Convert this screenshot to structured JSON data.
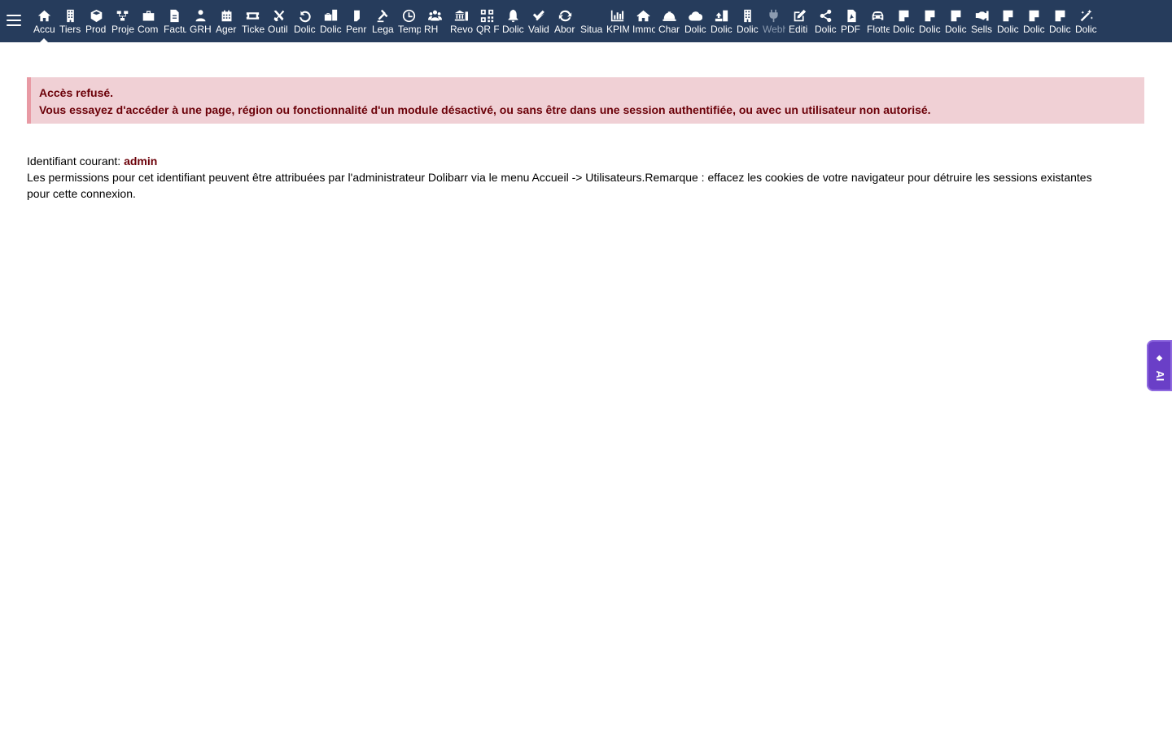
{
  "topbar": {
    "menu_items": [
      {
        "label": "Accu",
        "icon": "home-icon",
        "active": true
      },
      {
        "label": "Tiers",
        "icon": "building-icon"
      },
      {
        "label": "Prod",
        "icon": "cube-icon"
      },
      {
        "label": "Proje",
        "icon": "project-icon"
      },
      {
        "label": "Com",
        "icon": "briefcase-icon"
      },
      {
        "label": "Factu",
        "icon": "invoice-icon"
      },
      {
        "label": "GRH",
        "icon": "people-icon"
      },
      {
        "label": "Ager",
        "icon": "calendar-icon"
      },
      {
        "label": "Ticke",
        "icon": "ticket-icon"
      },
      {
        "label": "Outil",
        "icon": "tools-icon"
      },
      {
        "label": "Dolic",
        "icon": "undo-icon"
      },
      {
        "label": "Dolic",
        "icon": "briefcase-doc-icon"
      },
      {
        "label": "Penr",
        "icon": "doc-icon"
      },
      {
        "label": "Lega",
        "icon": "gavel-icon"
      },
      {
        "label": "Temp",
        "icon": "clock-icon"
      },
      {
        "label": "RH",
        "icon": "group-icon"
      },
      {
        "label": "Revo",
        "icon": "bank-icon"
      },
      {
        "label": "QR F",
        "icon": "qrcode-icon"
      },
      {
        "label": "Dolic",
        "icon": "bell-icon"
      },
      {
        "label": "Valid",
        "icon": "double-check-icon"
      },
      {
        "label": "Abor",
        "icon": "refresh-icon"
      },
      {
        "label": "Situa",
        "icon": "blank-icon"
      },
      {
        "label": "KPIM",
        "icon": "chart-icon"
      },
      {
        "label": "Immo",
        "icon": "house-icon"
      },
      {
        "label": "Char",
        "icon": "helmet-icon"
      },
      {
        "label": "Dolic",
        "icon": "cloud-icon"
      },
      {
        "label": "Dolic",
        "icon": "upload-icon"
      },
      {
        "label": "Dolic",
        "icon": "tower-icon"
      },
      {
        "label": "Webh",
        "icon": "plug-icon",
        "dim": true
      },
      {
        "label": "Editi",
        "icon": "edit-icon"
      },
      {
        "label": "Dolic",
        "icon": "share-icon"
      },
      {
        "label": "PDF",
        "icon": "pdf-icon"
      },
      {
        "label": "Flotte",
        "icon": "car-icon"
      },
      {
        "label": "Dolic",
        "icon": "note-icon"
      },
      {
        "label": "Dolic",
        "icon": "note-icon"
      },
      {
        "label": "Dolic",
        "icon": "note-icon"
      },
      {
        "label": "Sells",
        "icon": "handshake-icon"
      },
      {
        "label": "Dolic",
        "icon": "note-icon"
      },
      {
        "label": "Dolic",
        "icon": "note-icon"
      },
      {
        "label": "Dolic",
        "icon": "note-icon"
      },
      {
        "label": "Dolic",
        "icon": "magic-icon"
      }
    ],
    "colors": {
      "bar_background": "#263c5c",
      "icon": "#ffffff",
      "dim": "#8c9bb0"
    }
  },
  "error": {
    "title": "Accès refusé.",
    "message": "Vous essayez d'accéder à une page, région ou fonctionnalité d'un module désactivé, ou sans être dans une session authentifiée, ou avec un utilisateur non autorisé.",
    "colors": {
      "background": "#f0d0d5",
      "border": "#e89aa4",
      "text": "#6b0008"
    }
  },
  "info": {
    "login_label": "Identifiant courant: ",
    "login_value": "admin",
    "permissions_text": "Les permissions pour cet identifiant peuvent être attribuées par l'administrateur Dolibarr via le menu Accueil -> Utilisateurs.Remarque : effacez les cookies de votre navigateur pour détruire les sessions existantes pour cette connexion."
  },
  "ai_tab": {
    "label": "AI",
    "spark": "◆",
    "color": "#6a3fc7"
  }
}
